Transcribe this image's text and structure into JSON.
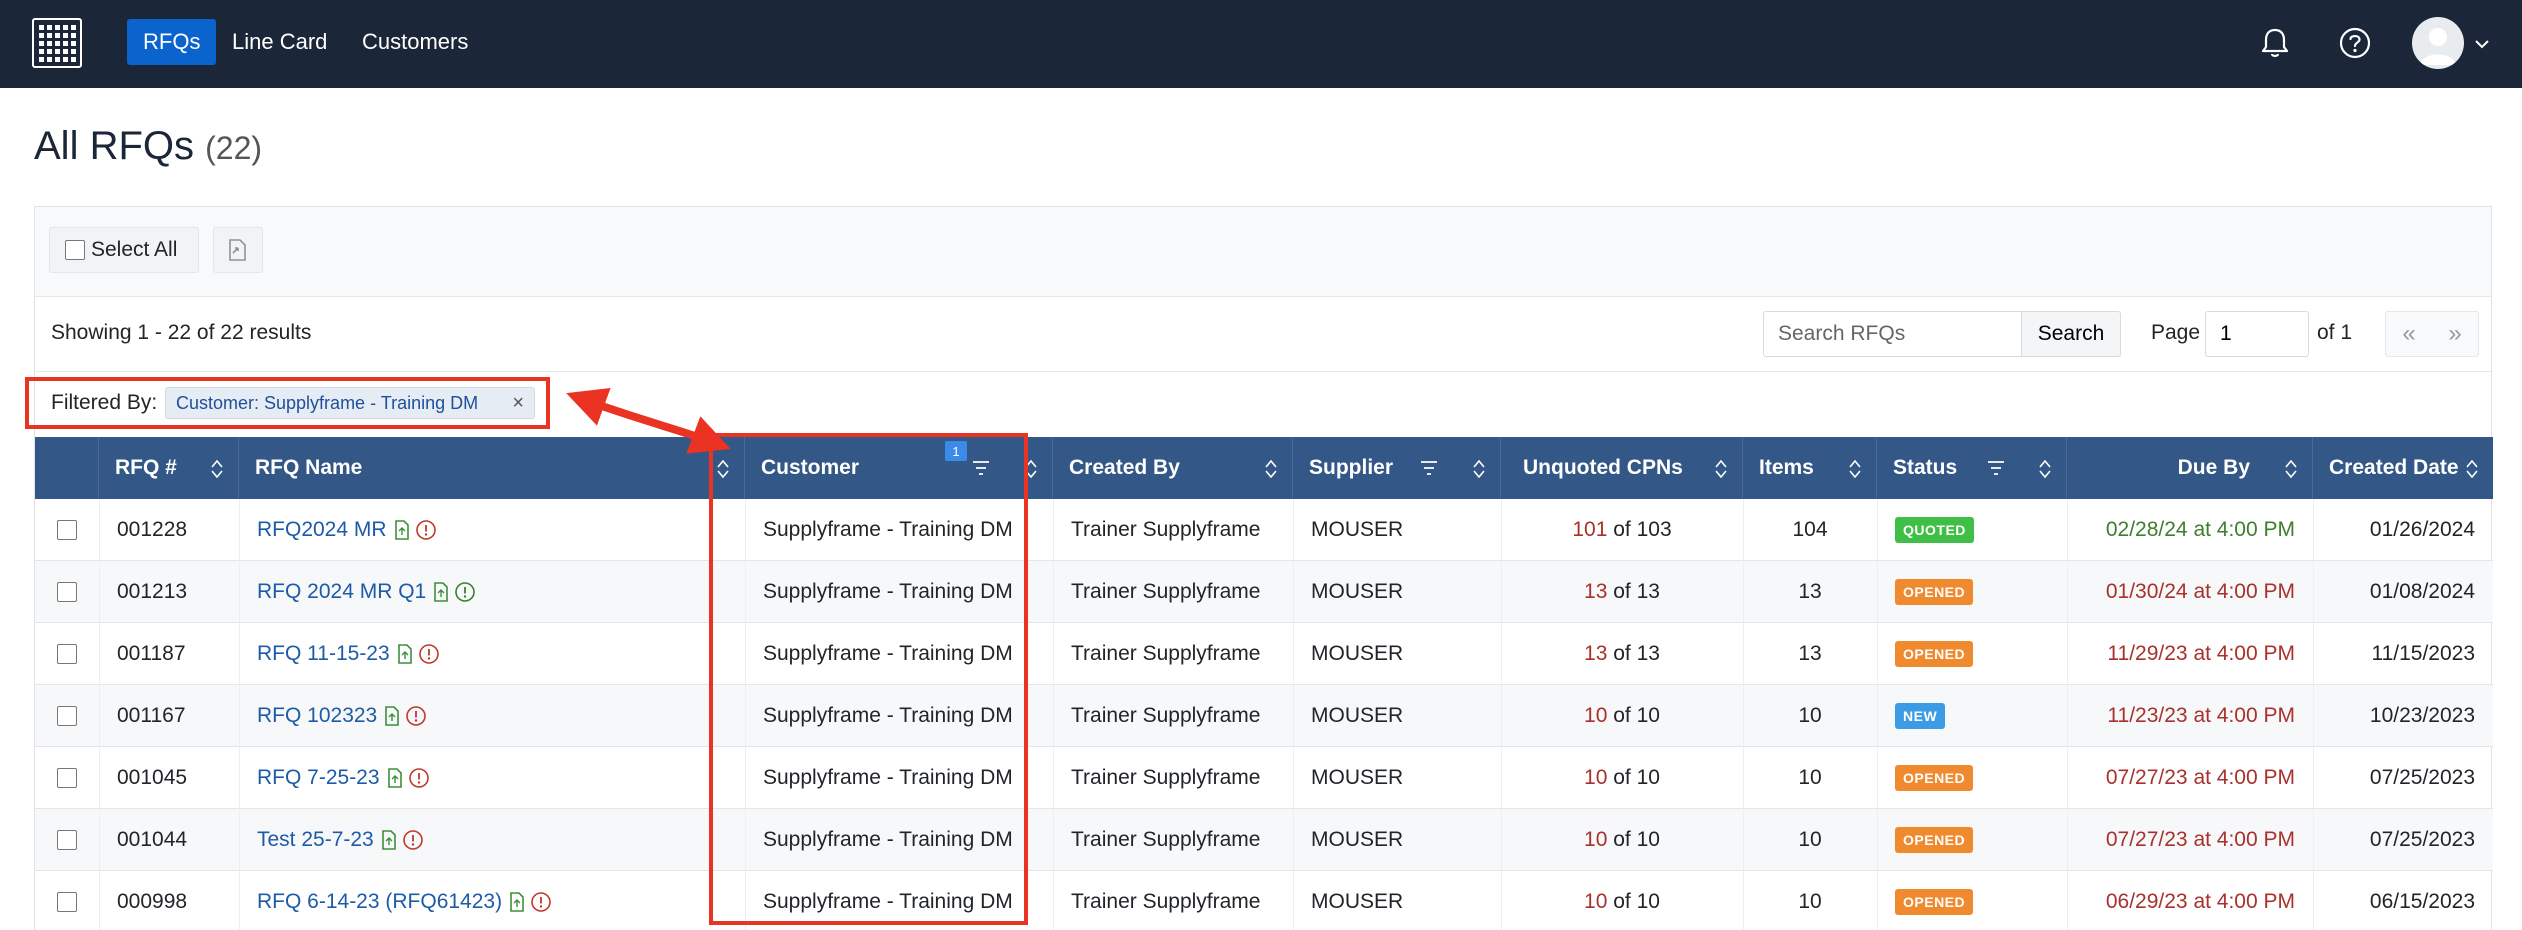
{
  "nav": {
    "items": [
      {
        "label": "RFQs",
        "active": true
      },
      {
        "label": "Line Card",
        "active": false
      },
      {
        "label": "Customers",
        "active": false
      }
    ],
    "icons": [
      "grid-logo-icon",
      "bell-icon",
      "help-icon",
      "user-avatar-icon",
      "chevron-down-icon"
    ]
  },
  "page": {
    "title": "All RFQs",
    "count": "(22)"
  },
  "toolbar": {
    "select_all_label": "Select All",
    "export_icon": "export-file-icon"
  },
  "results": {
    "showing_text": "Showing 1 - 22 of 22 results",
    "search_placeholder": "Search RFQs",
    "search_button": "Search",
    "page_label": "Page",
    "page_value": "1",
    "page_of": "of 1",
    "prev": "«",
    "next": "»"
  },
  "filter": {
    "label": "Filtered By:",
    "chip": "Customer: Supplyframe - Training DM",
    "chip_remove": "×",
    "count_badge": "1"
  },
  "table": {
    "columns": [
      "RFQ #",
      "RFQ Name",
      "Customer",
      "Created By",
      "Supplier",
      "Unquoted CPNs",
      "Items",
      "Status",
      "Due By",
      "Created Date"
    ],
    "rows": [
      {
        "rfq": "001228",
        "name": "RFQ2024 MR",
        "info_color": "red",
        "customer": "Supplyframe - Training DM",
        "created_by": "Trainer Supplyframe",
        "supplier": "MOUSER",
        "unquoted": "101",
        "unquoted_total": "of 103",
        "items": "104",
        "status": "QUOTED",
        "due": "02/28/24 at 4:00 PM",
        "due_color": "green",
        "created": "01/26/2024"
      },
      {
        "rfq": "001213",
        "name": "RFQ 2024 MR Q1",
        "info_color": "green",
        "customer": "Supplyframe - Training DM",
        "created_by": "Trainer Supplyframe",
        "supplier": "MOUSER",
        "unquoted": "13",
        "unquoted_total": "of 13",
        "items": "13",
        "status": "OPENED",
        "due": "01/30/24 at 4:00 PM",
        "due_color": "red",
        "created": "01/08/2024"
      },
      {
        "rfq": "001187",
        "name": "RFQ 11-15-23",
        "info_color": "red",
        "customer": "Supplyframe - Training DM",
        "created_by": "Trainer Supplyframe",
        "supplier": "MOUSER",
        "unquoted": "13",
        "unquoted_total": "of 13",
        "items": "13",
        "status": "OPENED",
        "due": "11/29/23 at 4:00 PM",
        "due_color": "red",
        "created": "11/15/2023"
      },
      {
        "rfq": "001167",
        "name": "RFQ 102323",
        "info_color": "red",
        "customer": "Supplyframe - Training DM",
        "created_by": "Trainer Supplyframe",
        "supplier": "MOUSER",
        "unquoted": "10",
        "unquoted_total": "of 10",
        "items": "10",
        "status": "NEW",
        "due": "11/23/23 at 4:00 PM",
        "due_color": "red",
        "created": "10/23/2023"
      },
      {
        "rfq": "001045",
        "name": "RFQ 7-25-23",
        "info_color": "red",
        "customer": "Supplyframe - Training DM",
        "created_by": "Trainer Supplyframe",
        "supplier": "MOUSER",
        "unquoted": "10",
        "unquoted_total": "of 10",
        "items": "10",
        "status": "OPENED",
        "due": "07/27/23 at 4:00 PM",
        "due_color": "red",
        "created": "07/25/2023"
      },
      {
        "rfq": "001044",
        "name": "Test 25-7-23",
        "info_color": "red",
        "customer": "Supplyframe - Training DM",
        "created_by": "Trainer Supplyframe",
        "supplier": "MOUSER",
        "unquoted": "10",
        "unquoted_total": "of 10",
        "items": "10",
        "status": "OPENED",
        "due": "07/27/23 at 4:00 PM",
        "due_color": "red",
        "created": "07/25/2023"
      },
      {
        "rfq": "000998",
        "name": "RFQ 6-14-23 (RFQ61423)",
        "info_color": "red",
        "customer": "Supplyframe - Training DM",
        "created_by": "Trainer Supplyframe",
        "supplier": "MOUSER",
        "unquoted": "10",
        "unquoted_total": "of 10",
        "items": "10",
        "status": "OPENED",
        "due": "06/29/23 at 4:00 PM",
        "due_color": "red",
        "created": "06/15/2023"
      }
    ]
  },
  "colors": {
    "nav_bg": "#1b2638",
    "nav_active": "#0b63ce",
    "table_header": "#335786",
    "link": "#1d5ba8",
    "overdue": "#a8312b",
    "upcoming": "#3d7f2f",
    "status_quoted": "#3fbf45",
    "status_opened": "#ef8a2f",
    "status_new": "#3b9be5",
    "annotation": "#ea3323"
  }
}
